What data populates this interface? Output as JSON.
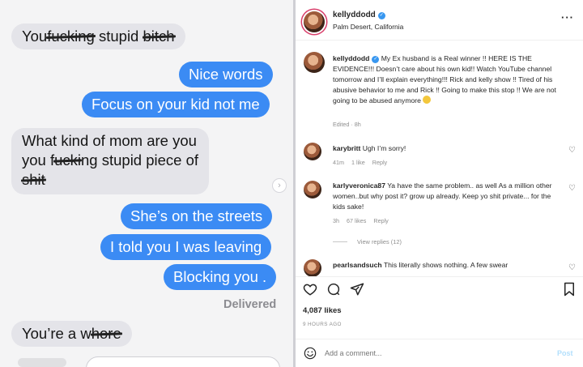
{
  "imessage": {
    "messages": [
      {
        "dir": "received",
        "parts": [
          {
            "t": "You"
          },
          {
            "t": "fucking",
            "s": true
          },
          {
            "t": " stupid "
          },
          {
            "t": "bitch",
            "s": true
          }
        ]
      },
      {
        "dir": "sent",
        "parts": [
          {
            "t": "Nice words"
          }
        ]
      },
      {
        "dir": "sent",
        "parts": [
          {
            "t": "Focus on your kid not me"
          }
        ]
      },
      {
        "dir": "received",
        "lines": [
          [
            {
              "t": "What kind of mom are you"
            }
          ],
          [
            {
              "t": "you f"
            },
            {
              "t": "ucki",
              "s": true
            },
            {
              "t": "ng stupid piece of"
            }
          ],
          [
            {
              "t": "shit",
              "s": true
            }
          ]
        ]
      },
      {
        "dir": "sent",
        "parts": [
          {
            "t": "She’s on the streets"
          }
        ]
      },
      {
        "dir": "sent",
        "parts": [
          {
            "t": "I told you I was leaving"
          }
        ]
      },
      {
        "dir": "sent",
        "parts": [
          {
            "t": "Blocking you ."
          }
        ]
      },
      {
        "dir": "received",
        "parts": [
          {
            "t": "You’re a w"
          },
          {
            "t": "hore",
            "s": true
          }
        ]
      }
    ],
    "delivered": "Delivered",
    "chevron_icon": "chevron-right-icon",
    "colors": {
      "sent": "#3b8bf4",
      "received": "#e4e4e9"
    }
  },
  "instagram": {
    "header": {
      "username": "kellyddodd",
      "location": "Palm Desert, California",
      "more_icon": "more-horizontal-icon"
    },
    "caption": {
      "username": "kellyddodd",
      "text": "My Ex husband is a Real winner !! HERE IS THE EVIDENCE!!! Doesn’t care about his own kid!! Watch YouTube channel tomorrow and I’ll explain everything!!! Rick and kelly show !! Tired of his abusive behavior to me and Rick !! Going to make this stop !! We are not going to be abused anymore",
      "meta": "Edited · 8h"
    },
    "comments": [
      {
        "username": "karybritt",
        "text": "Ugh I’m sorry!",
        "time": "41m",
        "likes": "1 like",
        "reply": "Reply"
      },
      {
        "username": "karlyveronica87",
        "text": "Ya have the same problem.. as well As a million other women..but why post it? grow up already. Keep yo shit private... for the kids sake!",
        "time": "3h",
        "likes": "67 likes",
        "reply": "Reply"
      },
      {
        "username": "pearlsandsuch",
        "text": "This literally shows nothing. A few swear"
      }
    ],
    "view_replies": "View replies (12)",
    "likes": "4,087 likes",
    "time_ago": "9 HOURS AGO",
    "add_comment_placeholder": "Add a comment...",
    "post_label": "Post",
    "icons": [
      "heart-icon",
      "comment-icon",
      "share-icon",
      "bookmark-icon",
      "smiley-icon"
    ]
  }
}
